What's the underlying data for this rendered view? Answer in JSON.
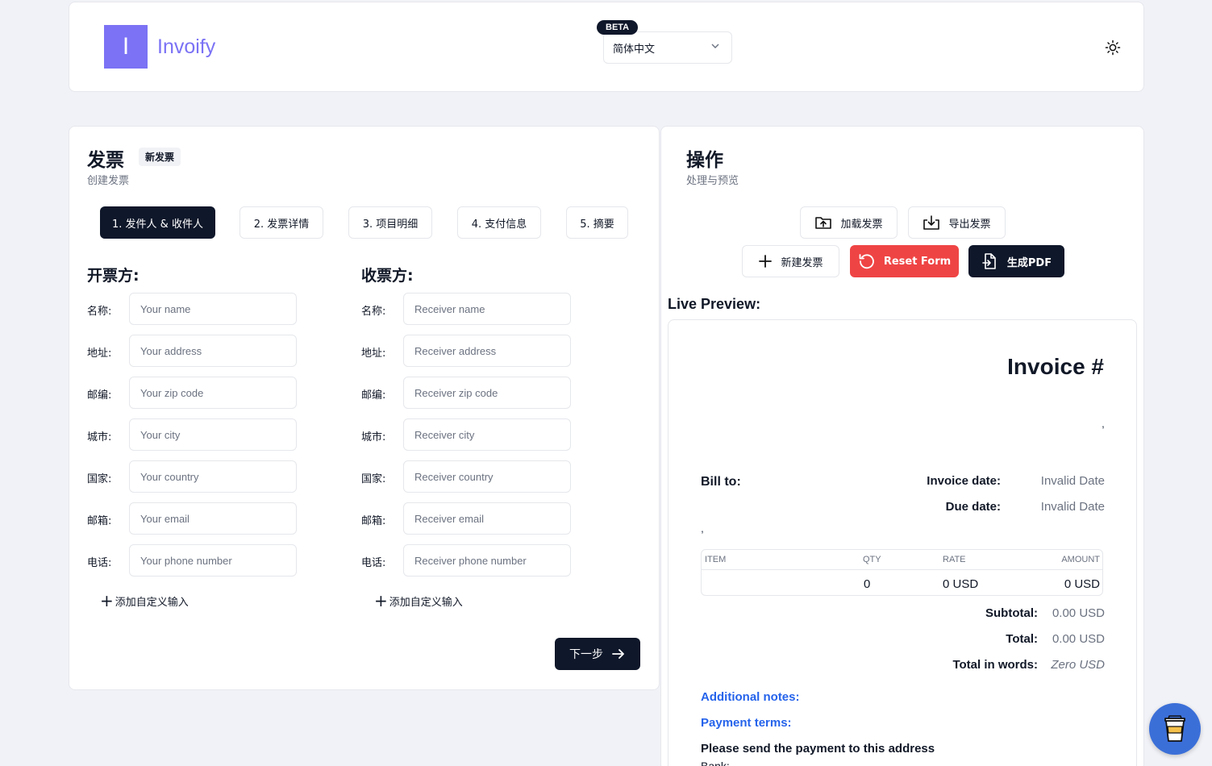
{
  "header": {
    "logo_letter": "I",
    "app_name": "Invoify",
    "beta_badge": "BETA",
    "language": "简体中文"
  },
  "form": {
    "title": "发票",
    "badge": "新发票",
    "subtitle": "创建发票",
    "steps": [
      "1. 发件人 & 收件人",
      "2. 发票详情",
      "3. 项目明细",
      "4. 支付信息",
      "5. 摘要"
    ],
    "active_step": 0,
    "sender": {
      "title": "开票方:",
      "fields": [
        {
          "label": "名称:",
          "placeholder": "Your name"
        },
        {
          "label": "地址:",
          "placeholder": "Your address"
        },
        {
          "label": "邮编:",
          "placeholder": "Your zip code"
        },
        {
          "label": "城市:",
          "placeholder": "Your city"
        },
        {
          "label": "国家:",
          "placeholder": "Your country"
        },
        {
          "label": "邮箱:",
          "placeholder": "Your email"
        },
        {
          "label": "电话:",
          "placeholder": "Your phone number"
        }
      ],
      "add_custom": "添加自定义输入"
    },
    "receiver": {
      "title": "收票方:",
      "fields": [
        {
          "label": "名称:",
          "placeholder": "Receiver name"
        },
        {
          "label": "地址:",
          "placeholder": "Receiver address"
        },
        {
          "label": "邮编:",
          "placeholder": "Receiver zip code"
        },
        {
          "label": "城市:",
          "placeholder": "Receiver city"
        },
        {
          "label": "国家:",
          "placeholder": "Receiver country"
        },
        {
          "label": "邮箱:",
          "placeholder": "Receiver email"
        },
        {
          "label": "电话:",
          "placeholder": "Receiver phone number"
        }
      ],
      "add_custom": "添加自定义输入"
    },
    "next_label": "下一步"
  },
  "actions": {
    "title": "操作",
    "subtitle": "处理与预览",
    "load_label": "加载发票",
    "export_label": "导出发票",
    "new_label": "新建发票",
    "reset_label": "Reset Form",
    "pdf_label": "生成PDF",
    "live_preview": "Live Preview:"
  },
  "preview": {
    "heading": "Invoice #",
    "comma": ",",
    "bill_to": "Bill to:",
    "invoice_date_label": "Invoice date:",
    "invoice_date_value": "Invalid Date",
    "due_date_label": "Due date:",
    "due_date_value": "Invalid Date",
    "table_headers": [
      "ITEM",
      "QTY",
      "RATE",
      "AMOUNT"
    ],
    "row": {
      "item": "",
      "qty": "0",
      "rate": "0 USD",
      "amount": "0 USD"
    },
    "subtotal_label": "Subtotal:",
    "subtotal_value": "0.00 USD",
    "total_label": "Total:",
    "total_value": "0.00 USD",
    "words_label": "Total in words:",
    "words_value": "Zero USD",
    "additional_notes": "Additional notes:",
    "payment_terms": "Payment terms:",
    "pay_address": "Please send the payment to this address",
    "bank_label": "Bank:"
  },
  "colors": {
    "brand": "#7b72f5",
    "dark": "#0f172a",
    "danger": "#ef4444",
    "link": "#2563eb",
    "coffee": "#3b6fd8"
  },
  "icons": [
    "sun-icon",
    "chevron-down-icon",
    "upload-icon",
    "download-icon",
    "plus-icon",
    "reset-icon",
    "file-export-icon",
    "arrow-right-icon",
    "coffee-cup-icon"
  ]
}
